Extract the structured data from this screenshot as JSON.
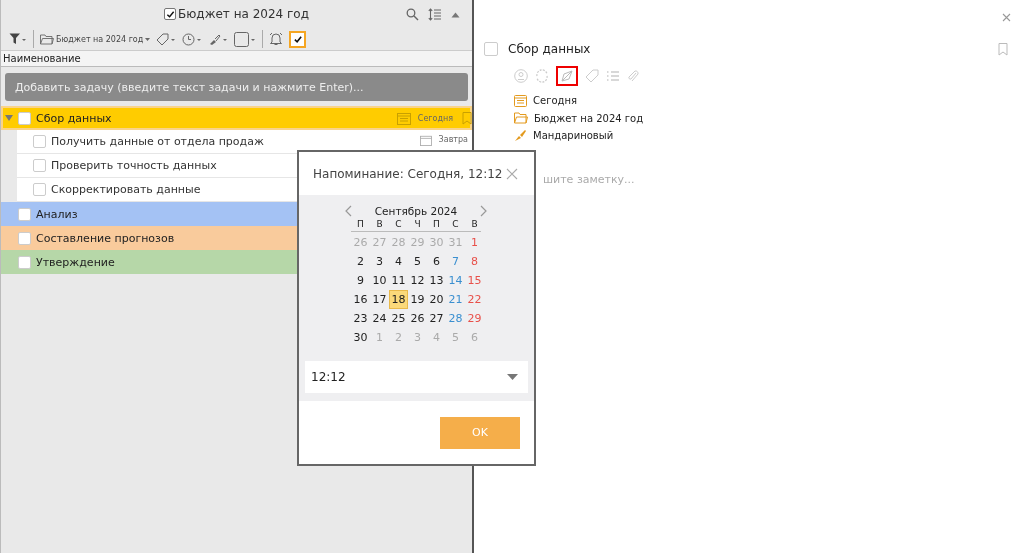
{
  "list_panel": {
    "title": {
      "label": "Бюджет на 2024 год",
      "checked": true
    },
    "toolbar": {
      "project": "Бюджет на 2024 год",
      "show_completed": {
        "selected": true
      }
    },
    "column_header": "Наименование",
    "add_task": {
      "placeholder": "Добавить задачу (введите текст задачи и нажмите Enter)..."
    },
    "tasks": [
      {
        "name": "Сбор данных",
        "checked": false,
        "expanded": true,
        "selected": true,
        "color": "#ffcc00",
        "due": "Сегодня",
        "children": [
          {
            "name": "Получить данные от отдела продаж",
            "checked": false,
            "due": "Завтра"
          },
          {
            "name": "Проверить точность данных",
            "checked": false
          },
          {
            "name": "Скорректировать данные",
            "checked": false
          }
        ]
      },
      {
        "name": "Анализ",
        "checked": false,
        "selected": false,
        "color": "#a4c2f4"
      },
      {
        "name": "Составление прогнозов",
        "checked": false,
        "selected": false,
        "color": "#f9cb9c"
      },
      {
        "name": "Утверждение",
        "checked": false,
        "selected": false,
        "color": "#b6d7a8"
      }
    ]
  },
  "detail_panel": {
    "task_title": "Сбор данных",
    "checked": false,
    "properties": [
      {
        "kind": "date",
        "text": "Сегодня"
      },
      {
        "kind": "project",
        "text": "Бюджет на 2024 год"
      },
      {
        "kind": "color",
        "text": "Мандариновый"
      }
    ],
    "note": {
      "placeholder": "шите заметку..."
    }
  },
  "reminder_dialog": {
    "title": "Напоминание: Сегодня, 12:12",
    "month": "Сентябрь 2024",
    "weekdays": [
      "П",
      "В",
      "С",
      "Ч",
      "П",
      "С",
      "В"
    ],
    "weeks": [
      [
        {
          "d": "26",
          "kind": "other"
        },
        {
          "d": "27",
          "kind": "other"
        },
        {
          "d": "28",
          "kind": "other"
        },
        {
          "d": "29",
          "kind": "other"
        },
        {
          "d": "30",
          "kind": "other"
        },
        {
          "d": "31",
          "kind": "other"
        },
        {
          "d": "1",
          "kind": "sunday"
        }
      ],
      [
        {
          "d": "2",
          "kind": "day"
        },
        {
          "d": "3",
          "kind": "day"
        },
        {
          "d": "4",
          "kind": "day"
        },
        {
          "d": "5",
          "kind": "day"
        },
        {
          "d": "6",
          "kind": "day"
        },
        {
          "d": "7",
          "kind": "saturday"
        },
        {
          "d": "8",
          "kind": "sunday"
        }
      ],
      [
        {
          "d": "9",
          "kind": "day"
        },
        {
          "d": "10",
          "kind": "day"
        },
        {
          "d": "11",
          "kind": "day"
        },
        {
          "d": "12",
          "kind": "day"
        },
        {
          "d": "13",
          "kind": "day"
        },
        {
          "d": "14",
          "kind": "saturday"
        },
        {
          "d": "15",
          "kind": "sunday"
        }
      ],
      [
        {
          "d": "16",
          "kind": "day"
        },
        {
          "d": "17",
          "kind": "day"
        },
        {
          "d": "18",
          "kind": "day",
          "selected": true
        },
        {
          "d": "19",
          "kind": "day"
        },
        {
          "d": "20",
          "kind": "day"
        },
        {
          "d": "21",
          "kind": "saturday"
        },
        {
          "d": "22",
          "kind": "sunday"
        }
      ],
      [
        {
          "d": "23",
          "kind": "day"
        },
        {
          "d": "24",
          "kind": "day"
        },
        {
          "d": "25",
          "kind": "day"
        },
        {
          "d": "26",
          "kind": "day"
        },
        {
          "d": "27",
          "kind": "day"
        },
        {
          "d": "28",
          "kind": "saturday"
        },
        {
          "d": "29",
          "kind": "sunday"
        }
      ],
      [
        {
          "d": "30",
          "kind": "day"
        },
        {
          "d": "1",
          "kind": "other"
        },
        {
          "d": "2",
          "kind": "other"
        },
        {
          "d": "3",
          "kind": "other"
        },
        {
          "d": "4",
          "kind": "other"
        },
        {
          "d": "5",
          "kind": "other"
        },
        {
          "d": "6",
          "kind": "other"
        }
      ]
    ],
    "time": "12:12",
    "ok_button": "OK"
  }
}
